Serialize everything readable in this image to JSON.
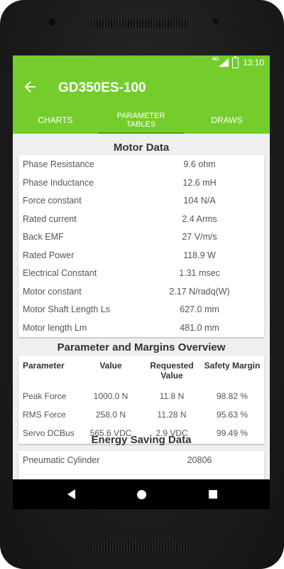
{
  "status_bar": {
    "network": "4G",
    "time": "13:10"
  },
  "app_bar": {
    "back_icon": "arrow-left-icon",
    "title": "GD350ES-100"
  },
  "tabs": [
    {
      "label": "CHARTS"
    },
    {
      "label": "PARAMETER TABLES"
    },
    {
      "label": "DRAWS"
    }
  ],
  "motor_data": {
    "title": "Motor Data",
    "rows": [
      {
        "label": "Phase Resistance",
        "value": "9.6 ohm"
      },
      {
        "label": "Phase Inductance",
        "value": "12.6 mH"
      },
      {
        "label": "Force constant",
        "value": "104 N/A"
      },
      {
        "label": "Rated current",
        "value": "2.4 Arms"
      },
      {
        "label": "Back EMF",
        "value": "27 V/m/s"
      },
      {
        "label": "Rated Power",
        "value": "118.9 W"
      },
      {
        "label": "Electrical Constant",
        "value": "1.31 msec"
      },
      {
        "label": "Motor constant",
        "value": "2.17 N/radq(W)"
      },
      {
        "label": "Motor Shaft Length Ls",
        "value": "627.0 mm"
      },
      {
        "label": "Motor length Lm",
        "value": "481.0 mm"
      }
    ]
  },
  "margins": {
    "title": "Parameter and Margins Overview",
    "headers": [
      "Parameter",
      "Value",
      "Requested Value",
      "Safety Margin"
    ],
    "rows": [
      [
        "Peak Force",
        "1000.0 N",
        "11.8 N",
        "98.82 %"
      ],
      [
        "RMS Force",
        "258.0 N",
        "11.28 N",
        "95.63 %"
      ],
      [
        "Servo DCBus",
        "565.6 VDC",
        "2.9 VDC",
        "99.49 %"
      ]
    ]
  },
  "energy": {
    "title": "Energy Saving Data",
    "rows": [
      {
        "label": "Pneumatic Cylinder",
        "value": "20806"
      }
    ]
  },
  "colors": {
    "accent": "#74cd2b",
    "tab_indicator": "#4e9a16",
    "background": "#efefef"
  }
}
